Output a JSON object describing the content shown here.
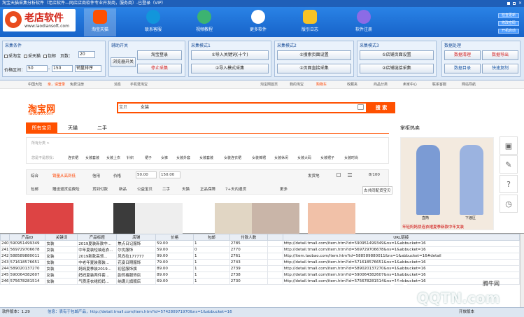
{
  "titlebar": {
    "text": "淘宝天猫采集分析软件（老店软件—网店店商软件专业开发商，服务商）-已登录（VIP）"
  },
  "logo": {
    "name": "老店软件",
    "url": "www.laodiansoft.com"
  },
  "nav": [
    {
      "label": "淘宝天猫",
      "icon": "taobao-icon",
      "color": "#ff5000",
      "active": true
    },
    {
      "label": "联系客服",
      "icon": "qq-penguin-icon",
      "color": "#1296db",
      "active": false
    },
    {
      "label": "视频教程",
      "icon": "video-icon",
      "color": "#3cb371",
      "active": false
    },
    {
      "label": "更多软件",
      "icon": "more-software-icon",
      "color": "#ffffff",
      "active": false
    },
    {
      "label": "版引日志",
      "icon": "notes-icon",
      "color": "#f7c325",
      "active": false
    },
    {
      "label": "软件注册",
      "icon": "register-icon",
      "color": "#8c6be6",
      "active": false
    }
  ],
  "side_buttons": [
    "检查更新",
    "修改密码",
    "开机启动"
  ],
  "panel": {
    "collect": {
      "title": "采集条件",
      "checks": [
        "采淘宝",
        "采天猫",
        "包邮"
      ],
      "pages_label": "页数：",
      "pages_value": "20",
      "price_label": "价格区间：",
      "price_min": "50",
      "price_max": "150",
      "sort_value": "销量排序"
    },
    "aux": {
      "title": "辅助开关",
      "browser_btn": "浏览器开关",
      "login_btn": "淘宝登录",
      "stop_btn": "停止采集"
    },
    "mode1": {
      "title": "采集模式1",
      "btn1": "①导入关键词(十个)",
      "btn2": "②导入模式采集"
    },
    "mode2": {
      "title": "采集模式2",
      "btn1": "①搜索页面设置",
      "btn2": "②页面直接采集"
    },
    "mode3": {
      "title": "采集模式3",
      "btn1": "①店铺页面设置",
      "btn2": "②店铺链接采集"
    },
    "data": {
      "title": "数据处理",
      "btn1": "数据清理",
      "btn2": "数据导出",
      "btn3": "数据目录",
      "btn4": "快速复制"
    }
  },
  "taobao": {
    "toplinks": [
      "中国大陆",
      "亲，请登录",
      "免费注册",
      "消息",
      "手机逛淘宝",
      "淘宝网首页",
      "我的淘宝",
      "购物车",
      "收藏夹",
      "商品分类",
      "卖家中心",
      "联系客服",
      "网站导航"
    ],
    "logo": "淘宝网",
    "logo_sub": "Taobao.com",
    "search_select": "宝贝",
    "search_text": "女装",
    "search_btn": "搜 索",
    "tabs": [
      "所有宝贝",
      "天猫",
      "二手"
    ],
    "right_title": "掌柜热卖",
    "filter_all": "所有分类 >",
    "filter_label": "您是不是想找：",
    "filter_items": [
      "连衣裙",
      "女装套装",
      "女装上衣",
      "针织",
      "裙子",
      "女裤",
      "女装外套",
      "女装套装",
      "女装连衣裙",
      "女装裤裙",
      "女装休闲",
      "女装大码",
      "女装裙子",
      "女装时尚"
    ],
    "sort_items": [
      "综合",
      "销量从高到低",
      "信用",
      "价格",
      "50.00",
      "150.00",
      "发货地",
      "8/100"
    ],
    "check_items": [
      "包邮",
      "赠送退货运费险",
      "货到付款",
      "新品",
      "公益宝贝",
      "二手",
      "天猫",
      "正品保障",
      "7+天内退货",
      "更多"
    ],
    "right_button": "去共同配货宝贝",
    "ad_left": "直筒",
    "ad_right": "下渡区",
    "ad_caption": "年轻妈妈拼连衣裙夏季新款中年女装"
  },
  "grid": {
    "headers": [
      "",
      "产品ID",
      "关键词",
      "产品标题",
      "店铺",
      "价格",
      "包邮",
      "付款人数",
      "",
      "URL链接"
    ],
    "rows": [
      [
        "240",
        "590951499349",
        "女装",
        "2019夏装新款中...",
        "焦点日记服饰",
        "59.00",
        "1",
        "2785",
        "",
        "http://detail.tmall.com/item.htm?id=590951499349&ns=1&abbucket=16"
      ],
      [
        "241",
        "569729706678",
        "女装",
        "中年夏装短袖连衣...",
        "尔优服饰",
        "59.00",
        "0",
        "2770",
        "",
        "http://detail.tmall.com/item.htm?id=569729706678&ns=1&abbucket=16"
      ],
      [
        "242",
        "588589880011",
        "女装",
        "2019新款高领...",
        "风尚拉177777",
        "99.00",
        "1",
        "2761",
        "",
        "http://item.taobao.com/item.htm?id=588589880011&ns=1&abbucket=16#detail"
      ],
      [
        "243",
        "571618576651",
        "女装",
        "中老年夏装套装...",
        "花姿日期服饰",
        "79.00",
        "1",
        "2743",
        "",
        "http://detail.tmall.com/item.htm?id=571618576651&ns=1&abbucket=16"
      ],
      [
        "244",
        "589020137270",
        "女装",
        "妈妈夏季装2019...",
        "初蓝服饰旗",
        "89.00",
        "1",
        "2739",
        "",
        "http://detail.tmall.com/item.htm?id=589020137270&ns=1&abbucket=16"
      ],
      [
        "245",
        "590064382607",
        "女装",
        "妈妈夏装两件套...",
        "韵芳格服饰店",
        "89.00",
        "1",
        "2738",
        "",
        "http://detail.tmall.com/item.htm?id=590064382607&ns=1&abbucket=16"
      ],
      [
        "246",
        "575678281514",
        "女装",
        "气质连衣裙妈妈...",
        "纳珊儿旗舰店",
        "69.00",
        "1",
        "2730",
        "",
        "http://detail.tmall.com/item.htm?id=575678281514&ns=1&abbucket=16"
      ]
    ]
  },
  "status": {
    "version_label": "软件版本：1.29",
    "info": "信息：表有于包邮产品，http://detail.tmall.com/item.htm?id=574280971970&ns=1&abbucket=16",
    "trial": "开放版本"
  },
  "watermark": {
    "text": "QQTN.com",
    "sub": "腾牛网"
  }
}
